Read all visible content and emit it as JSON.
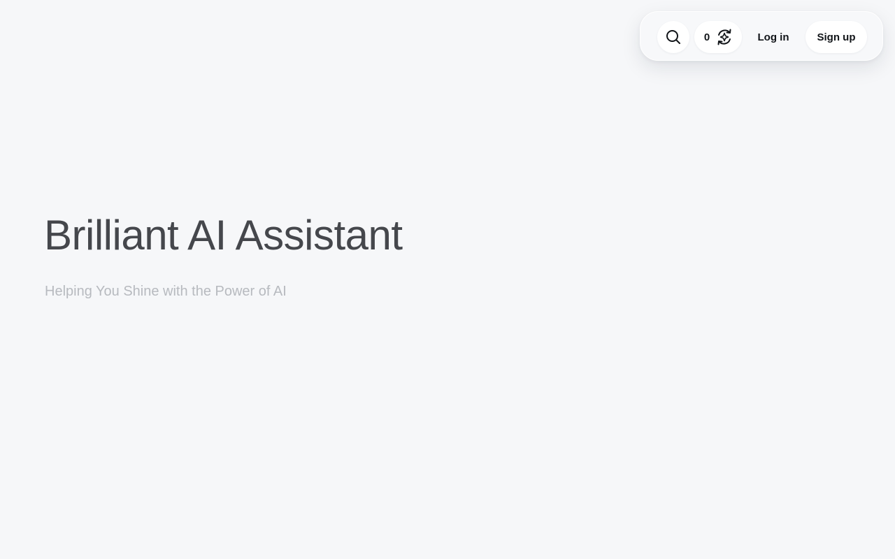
{
  "header": {
    "search": {
      "icon": "search-icon"
    },
    "credits": {
      "count": "0",
      "icon": "credits-refresh-icon"
    },
    "login_label": "Log in",
    "signup_label": "Sign up"
  },
  "hero": {
    "title": "Brilliant AI Assistant",
    "subtitle": "Helping You Shine with the Power of AI"
  },
  "colors": {
    "background": "#f6f7f9",
    "title_text": "#45474c",
    "subtitle_text": "#b7babf",
    "button_background": "#ffffff",
    "button_text": "#111418"
  }
}
